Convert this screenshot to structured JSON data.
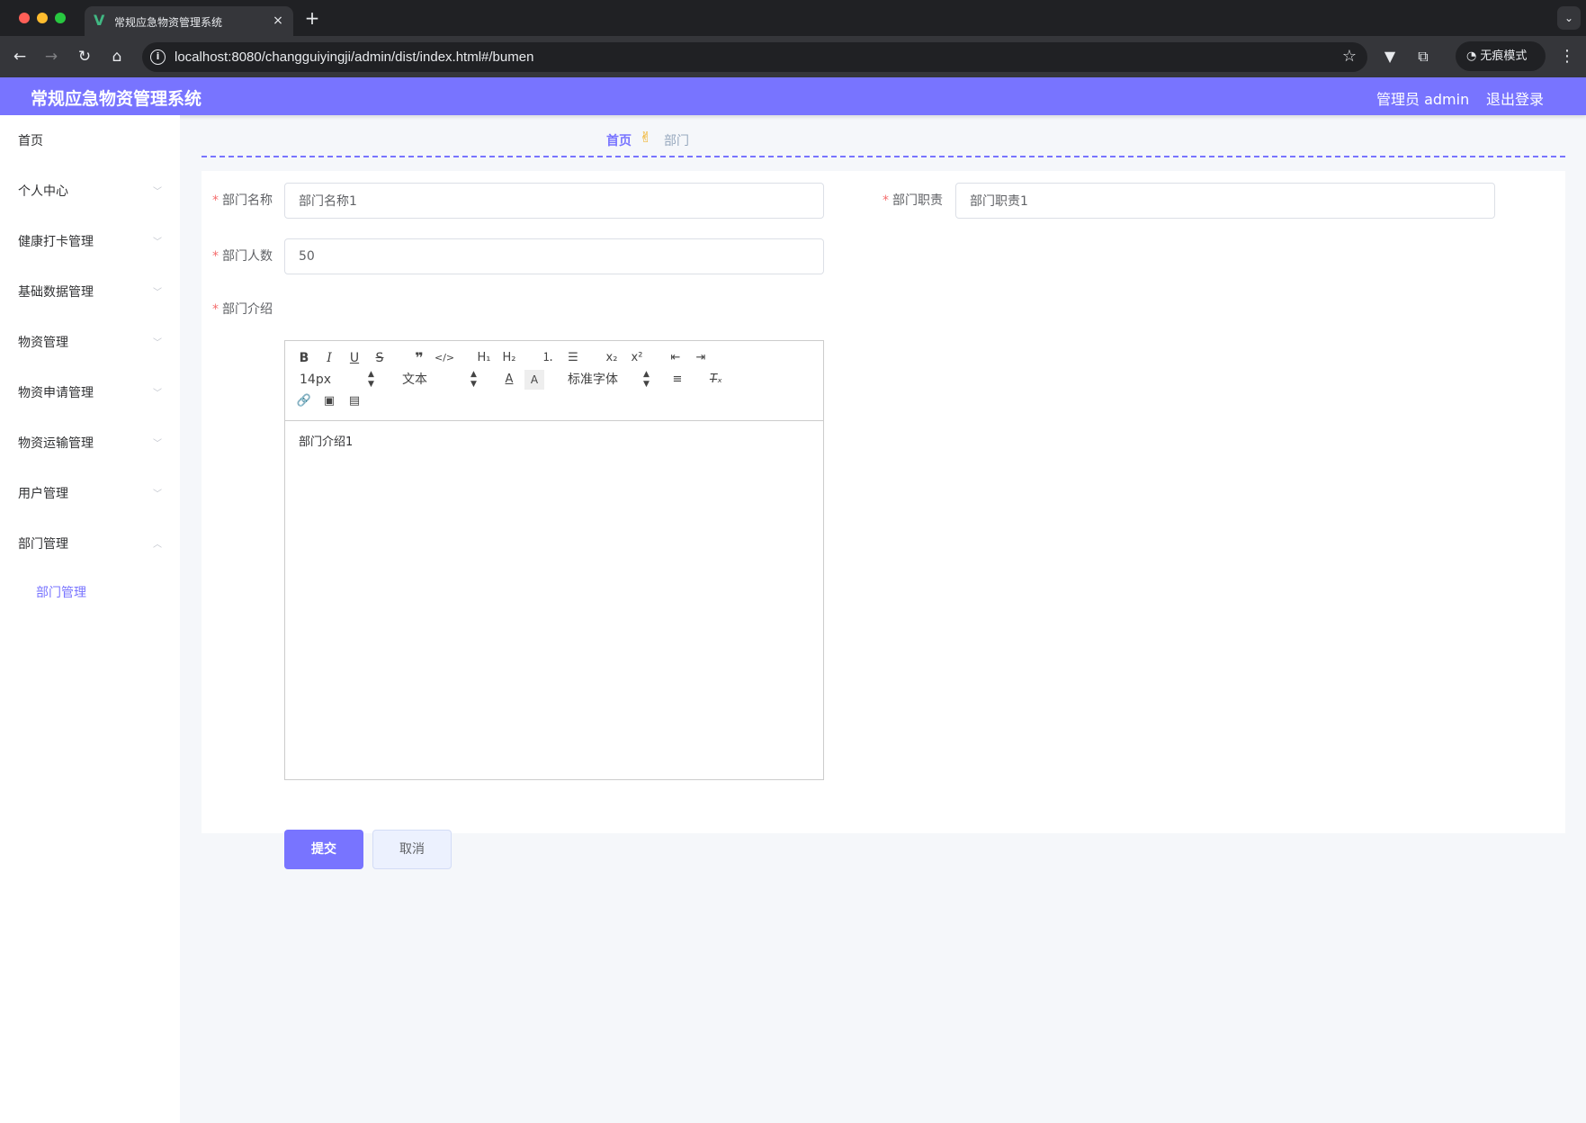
{
  "browser": {
    "tab_title": "常规应急物资管理系统",
    "tab_close": "×",
    "new_tab": "+",
    "tab_search": "⌄",
    "url": "localhost:8080/changguiyingji/admin/dist/index.html#/bumen",
    "incognito_label": "无痕模式",
    "nav": {
      "back": "←",
      "forward": "→",
      "reload": "↻",
      "home": "⌂"
    },
    "star": "☆",
    "menu": "⋮"
  },
  "header": {
    "title": "常规应急物资管理系统",
    "user": "管理员 admin",
    "logout": "退出登录",
    "accent_color": "#7874ff"
  },
  "sidebar": {
    "items": [
      {
        "label": "首页",
        "has_arrow": false
      },
      {
        "label": "个人中心",
        "has_arrow": true
      },
      {
        "label": "健康打卡管理",
        "has_arrow": true
      },
      {
        "label": "基础数据管理",
        "has_arrow": true
      },
      {
        "label": "物资管理",
        "has_arrow": true
      },
      {
        "label": "物资申请管理",
        "has_arrow": true
      },
      {
        "label": "物资运输管理",
        "has_arrow": true
      },
      {
        "label": "用户管理",
        "has_arrow": true
      },
      {
        "label": "部门管理",
        "has_arrow": true,
        "expanded": true
      }
    ],
    "active_sub": "部门管理"
  },
  "breadcrumb": {
    "home": "首页",
    "separator_icon": "✌",
    "current": "部门"
  },
  "form": {
    "name_label": "部门名称",
    "name_value": "部门名称1",
    "duty_label": "部门职责",
    "duty_value": "部门职责1",
    "count_label": "部门人数",
    "count_value": "50",
    "intro_label": "部门介绍",
    "intro_value": "部门介绍1",
    "required_mark": "*",
    "submit": "提交",
    "cancel": "取消"
  },
  "editor_toolbar": {
    "font_size": "14px",
    "header_select": "文本",
    "font_family": "标准字体"
  }
}
